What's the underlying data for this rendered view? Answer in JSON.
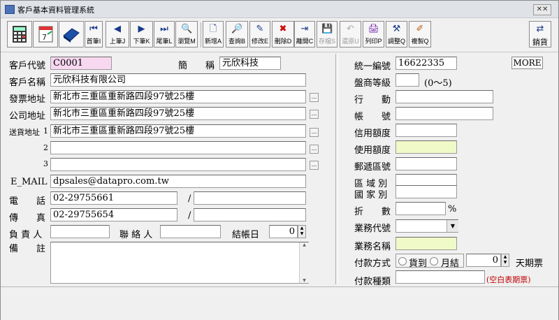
{
  "window": {
    "title": "客戶基本資料管理系統",
    "close_label": "✕✕"
  },
  "toolbar": {
    "nav": {
      "first": "首筆I",
      "prev": "上筆J",
      "next": "下筆K",
      "last": "尾筆L",
      "browse": "瀏覽M"
    },
    "actions": {
      "add": "新增A",
      "query": "查詢B",
      "edit": "修改E",
      "delete": "刪除D",
      "exit": "離開C",
      "save": "存檔S",
      "restore": "還原U",
      "print": "列印P",
      "adjust": "調整Q",
      "copy": "複製Q"
    },
    "sales": "銷貨"
  },
  "left": {
    "customer_code": {
      "label": "客戶代號",
      "value": "C0001"
    },
    "short_name": {
      "label": "簡　　稱",
      "value": "元欣科技"
    },
    "customer_name": {
      "label": "客戶名稱",
      "value": "元欣科技有限公司"
    },
    "invoice_address": {
      "label": "發票地址",
      "value": "新北市三重區重新路四段97號25樓"
    },
    "company_address": {
      "label": "公司地址",
      "value": "新北市三重區重新路四段97號25樓"
    },
    "delivery_label": "送貨地址",
    "delivery": [
      {
        "num": "1",
        "value": "新北市三重區重新路四段97號25樓"
      },
      {
        "num": "2",
        "value": ""
      },
      {
        "num": "3",
        "value": ""
      }
    ],
    "email": {
      "label": "E_MAIL",
      "value": "dpsales@datapro.com.tw"
    },
    "phone": {
      "label": "電　　話",
      "value": "02-29755661",
      "value2": ""
    },
    "fax": {
      "label": "傳　　真",
      "value": "02-29755654",
      "value2": ""
    },
    "slash": "/",
    "owner": {
      "label": "負 責 人",
      "value": ""
    },
    "contact": {
      "label": "聯 絡 人",
      "value": ""
    },
    "closing_day": {
      "label": "結帳日",
      "value": "0"
    },
    "remarks": {
      "label": "備　　註",
      "value": ""
    }
  },
  "right": {
    "more_label": "MORE",
    "tax_id": {
      "label": "統一編號",
      "value": "16622335"
    },
    "dealer_level": {
      "label": "盤商等級",
      "value": "",
      "hint": "(0～5)"
    },
    "mobile": {
      "label": "行　　動",
      "value": ""
    },
    "account": {
      "label": "帳　　號",
      "value": ""
    },
    "credit_limit": {
      "label": "信用額度",
      "value": ""
    },
    "used_limit": {
      "label": "使用額度",
      "value": ""
    },
    "postal_code": {
      "label": "郵遞區號",
      "value": ""
    },
    "region": {
      "label": "區 域 別",
      "value": ""
    },
    "country": {
      "label": "國 家 別",
      "value": ""
    },
    "discount": {
      "label": "折　　數",
      "value": "",
      "unit": "%"
    },
    "sales_code": {
      "label": "業務代號",
      "value": ""
    },
    "sales_name": {
      "label": "業務名稱",
      "value": ""
    },
    "payment_method": {
      "label": "付款方式",
      "options": [
        "貨到",
        "月結"
      ],
      "value": "0",
      "unit": "天期票"
    },
    "payment_type": {
      "label": "付款種類",
      "value": "",
      "hint": "(空白表期票)"
    }
  },
  "colors": {
    "pink": "#f8d8f0",
    "yellow": "#f0fac8",
    "hint_red": "#c00000"
  }
}
